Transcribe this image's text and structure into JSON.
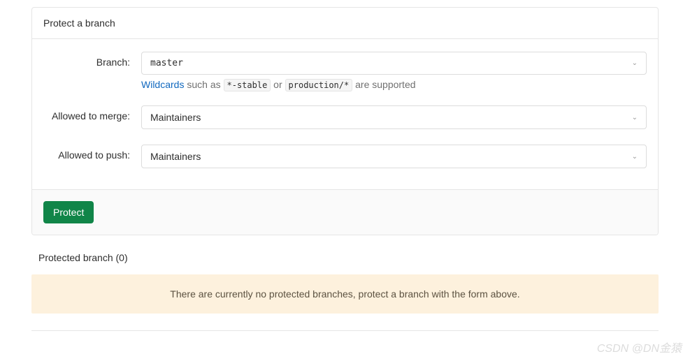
{
  "panel": {
    "title": "Protect a branch",
    "branch": {
      "label": "Branch:",
      "value": "master",
      "help_prefix_link": "Wildcards",
      "help_text_1": " such as ",
      "help_code_1": "*-stable",
      "help_text_2": " or ",
      "help_code_2": "production/*",
      "help_text_3": " are supported"
    },
    "allowed_merge": {
      "label": "Allowed to merge:",
      "value": "Maintainers"
    },
    "allowed_push": {
      "label": "Allowed to push:",
      "value": "Maintainers"
    },
    "submit_label": "Protect"
  },
  "protected": {
    "title": "Protected branch (0)",
    "empty_message": "There are currently no protected branches, protect a branch with the form above."
  },
  "watermark": "CSDN @DN金猿"
}
